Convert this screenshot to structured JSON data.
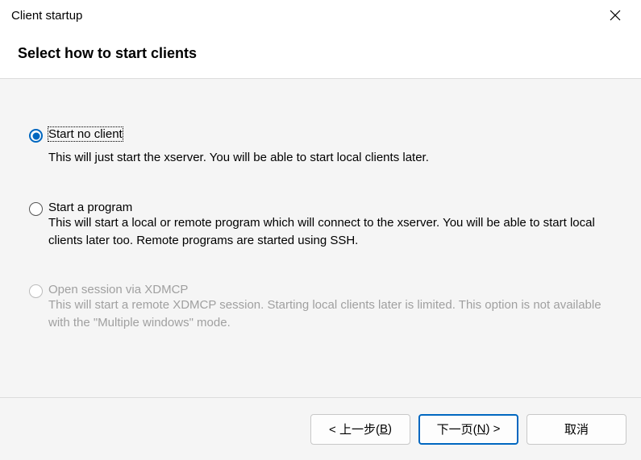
{
  "window": {
    "title": "Client startup"
  },
  "header": {
    "title": "Select how to start clients"
  },
  "options": [
    {
      "id": "start-no-client",
      "label": "Start no client",
      "description": "This will just start the xserver. You will be able to start local clients later.",
      "selected": true,
      "disabled": false,
      "focused": true
    },
    {
      "id": "start-a-program",
      "label": "Start a program",
      "description": "This will start a local or remote program which will connect to the xserver. You will be able to start local clients later too. Remote programs are started using SSH.",
      "selected": false,
      "disabled": false,
      "focused": false
    },
    {
      "id": "open-session-xdmcp",
      "label": "Open session via XDMCP",
      "description": "This will start a remote XDMCP session. Starting local clients later is limited. This option is not available with the \"Multiple windows\" mode.",
      "selected": false,
      "disabled": true,
      "focused": false
    }
  ],
  "buttons": {
    "back": {
      "prefix": "< 上一步(",
      "access": "B",
      "suffix": ")"
    },
    "next": {
      "prefix": "下一页(",
      "access": "N",
      "suffix": ") >"
    },
    "cancel": "取消"
  }
}
